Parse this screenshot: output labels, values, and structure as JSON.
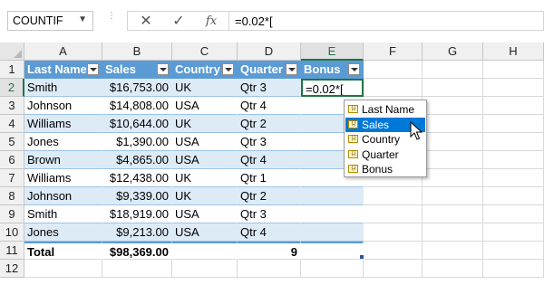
{
  "formula_bar": {
    "name_box": "COUNTIF",
    "cancel_icon": "✕",
    "enter_icon": "✓",
    "fx_label": "fx",
    "formula": "=0.02*["
  },
  "columns": [
    "A",
    "B",
    "C",
    "D",
    "E",
    "F",
    "G",
    "H"
  ],
  "rows": [
    "1",
    "2",
    "3",
    "4",
    "5",
    "6",
    "7",
    "8",
    "9",
    "10",
    "11",
    "12"
  ],
  "table": {
    "headers": [
      "Last Name",
      "Sales",
      "Country",
      "Quarter",
      "Bonus"
    ],
    "data": [
      [
        "Smith",
        "$16,753.00",
        "UK",
        "Qtr 3"
      ],
      [
        "Johnson",
        "$14,808.00",
        "USA",
        "Qtr 4"
      ],
      [
        "Williams",
        "$10,644.00",
        "UK",
        "Qtr 2"
      ],
      [
        "Jones",
        "$1,390.00",
        "USA",
        "Qtr 3"
      ],
      [
        "Brown",
        "$4,865.00",
        "USA",
        "Qtr 4"
      ],
      [
        "Williams",
        "$12,438.00",
        "UK",
        "Qtr 1"
      ],
      [
        "Johnson",
        "$9,339.00",
        "UK",
        "Qtr 2"
      ],
      [
        "Smith",
        "$18,919.00",
        "USA",
        "Qtr 3"
      ],
      [
        "Jones",
        "$9,213.00",
        "USA",
        "Qtr 4"
      ]
    ],
    "editing_cell": "=0.02*[",
    "total": [
      "Total",
      "$98,369.00",
      "",
      "9"
    ]
  },
  "autocomplete": {
    "items": [
      "Last Name",
      "Sales",
      "Country",
      "Quarter",
      "Bonus"
    ],
    "selected_index": 1,
    "icon": "(...)"
  },
  "colors": {
    "header_blue": "#5b9bd5",
    "band_blue": "#ddebf7",
    "excel_green": "#217346",
    "selection_blue": "#0078d7"
  }
}
